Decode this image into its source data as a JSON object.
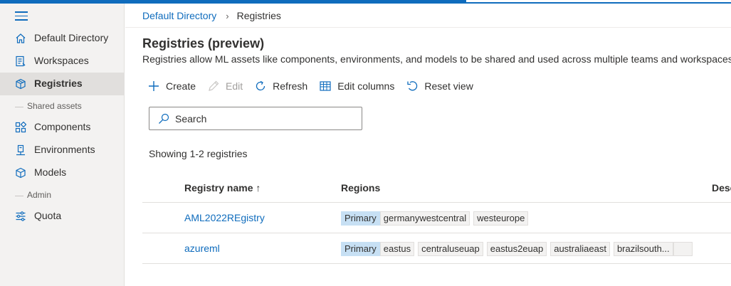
{
  "breadcrumb": {
    "root": "Default Directory",
    "separator": "›",
    "current": "Registries"
  },
  "sidebar": {
    "items": [
      {
        "label": "Default Directory",
        "icon": "home-icon"
      },
      {
        "label": "Workspaces",
        "icon": "workspaces-icon"
      },
      {
        "label": "Registries",
        "icon": "registries-icon",
        "active": true
      },
      {
        "label": "Components",
        "icon": "components-icon"
      },
      {
        "label": "Environments",
        "icon": "environments-icon"
      },
      {
        "label": "Models",
        "icon": "models-icon"
      },
      {
        "label": "Quota",
        "icon": "quota-icon"
      }
    ],
    "sections": {
      "shared_assets": "Shared assets",
      "admin": "Admin"
    }
  },
  "page": {
    "title": "Registries (preview)",
    "description": "Registries allow ML assets like components, environments, and models to be shared and used across multiple teams and workspaces in"
  },
  "toolbar": {
    "create": "Create",
    "edit": "Edit",
    "refresh": "Refresh",
    "edit_columns": "Edit columns",
    "reset_view": "Reset view"
  },
  "search": {
    "placeholder": "Search"
  },
  "showing": "Showing 1-2 registries",
  "grid": {
    "columns": {
      "name": "Registry name ↑",
      "regions": "Regions",
      "description": "Desc"
    },
    "rows": [
      {
        "name": "AML2022REgistry",
        "primary": "Primary",
        "regions": [
          "germanywestcentral",
          "westeurope"
        ]
      },
      {
        "name": "azureml",
        "primary": "Primary",
        "regions": [
          "eastus",
          "centraluseuap",
          "eastus2euap",
          "australiaeast",
          "brazilsouth..."
        ]
      }
    ]
  },
  "colors": {
    "accent": "#0f6cbd",
    "primary_tag": "#c7e0f4",
    "sidebar_bg": "#f3f2f1"
  }
}
